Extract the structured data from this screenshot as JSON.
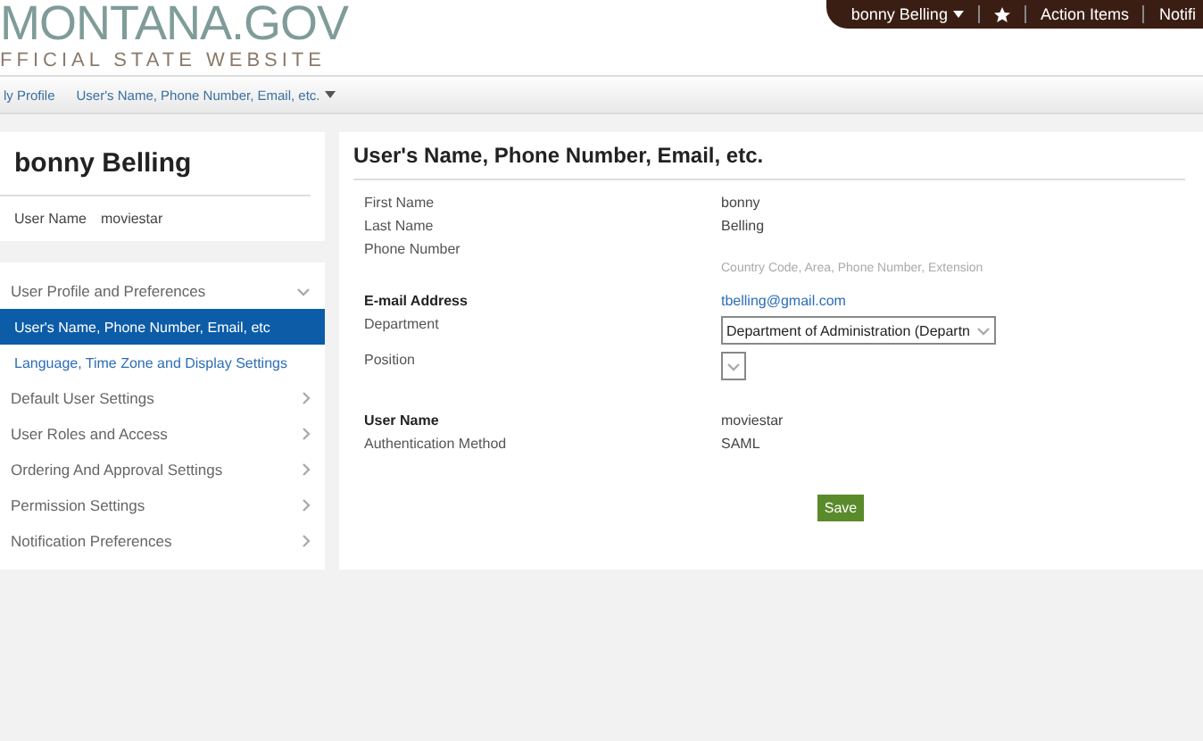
{
  "header": {
    "logo_title": "MONTANA.GOV",
    "logo_subtitle": "FFICIAL STATE WEBSITE",
    "user_menu": "bonny Belling",
    "links": [
      "Action Items",
      "Notifi"
    ]
  },
  "breadcrumb": [
    {
      "label": "ly Profile",
      "dropdown": false
    },
    {
      "label": "User's Name, Phone Number, Email, etc.",
      "dropdown": true
    }
  ],
  "profile": {
    "name": "bonny Belling",
    "user_name_label": "User Name",
    "user_name": "moviestar"
  },
  "nav": [
    {
      "label": "User Profile and Preferences",
      "kind": "section",
      "expanded": true
    },
    {
      "label": "User's Name, Phone Number, Email, etc",
      "kind": "sub",
      "selected": true
    },
    {
      "label": "Language, Time Zone and Display Settings",
      "kind": "sub",
      "selected": false
    },
    {
      "label": "Default User Settings",
      "kind": "section",
      "expanded": false
    },
    {
      "label": "User Roles and Access",
      "kind": "section",
      "expanded": false
    },
    {
      "label": "Ordering And Approval Settings",
      "kind": "section",
      "expanded": false
    },
    {
      "label": "Permission Settings",
      "kind": "section",
      "expanded": false
    },
    {
      "label": "Notification Preferences",
      "kind": "section",
      "expanded": false
    }
  ],
  "form": {
    "title": "User's Name, Phone Number, Email, etc.",
    "rows": [
      {
        "label": "First Name",
        "kind": "text",
        "bold": false,
        "value": "bonny"
      },
      {
        "label": "Last Name",
        "kind": "text",
        "bold": false,
        "value": "Belling"
      },
      {
        "label": "Phone Number",
        "kind": "phone",
        "bold": false,
        "hint": "Country Code, Area, Phone Number, Extension"
      },
      {
        "label": "E-mail Address",
        "kind": "link",
        "bold": true,
        "value": "tbelling@gmail.com"
      },
      {
        "label": "Department",
        "kind": "select",
        "bold": false,
        "value": "Department of Administration (Departn"
      },
      {
        "label": "Position",
        "kind": "select",
        "bold": false
      },
      {
        "label": "User Name",
        "kind": "text",
        "bold": true,
        "value": "moviestar",
        "gap": true
      },
      {
        "label": "Authentication Method",
        "kind": "text",
        "bold": false,
        "value": "SAML"
      }
    ],
    "save": "Save"
  }
}
